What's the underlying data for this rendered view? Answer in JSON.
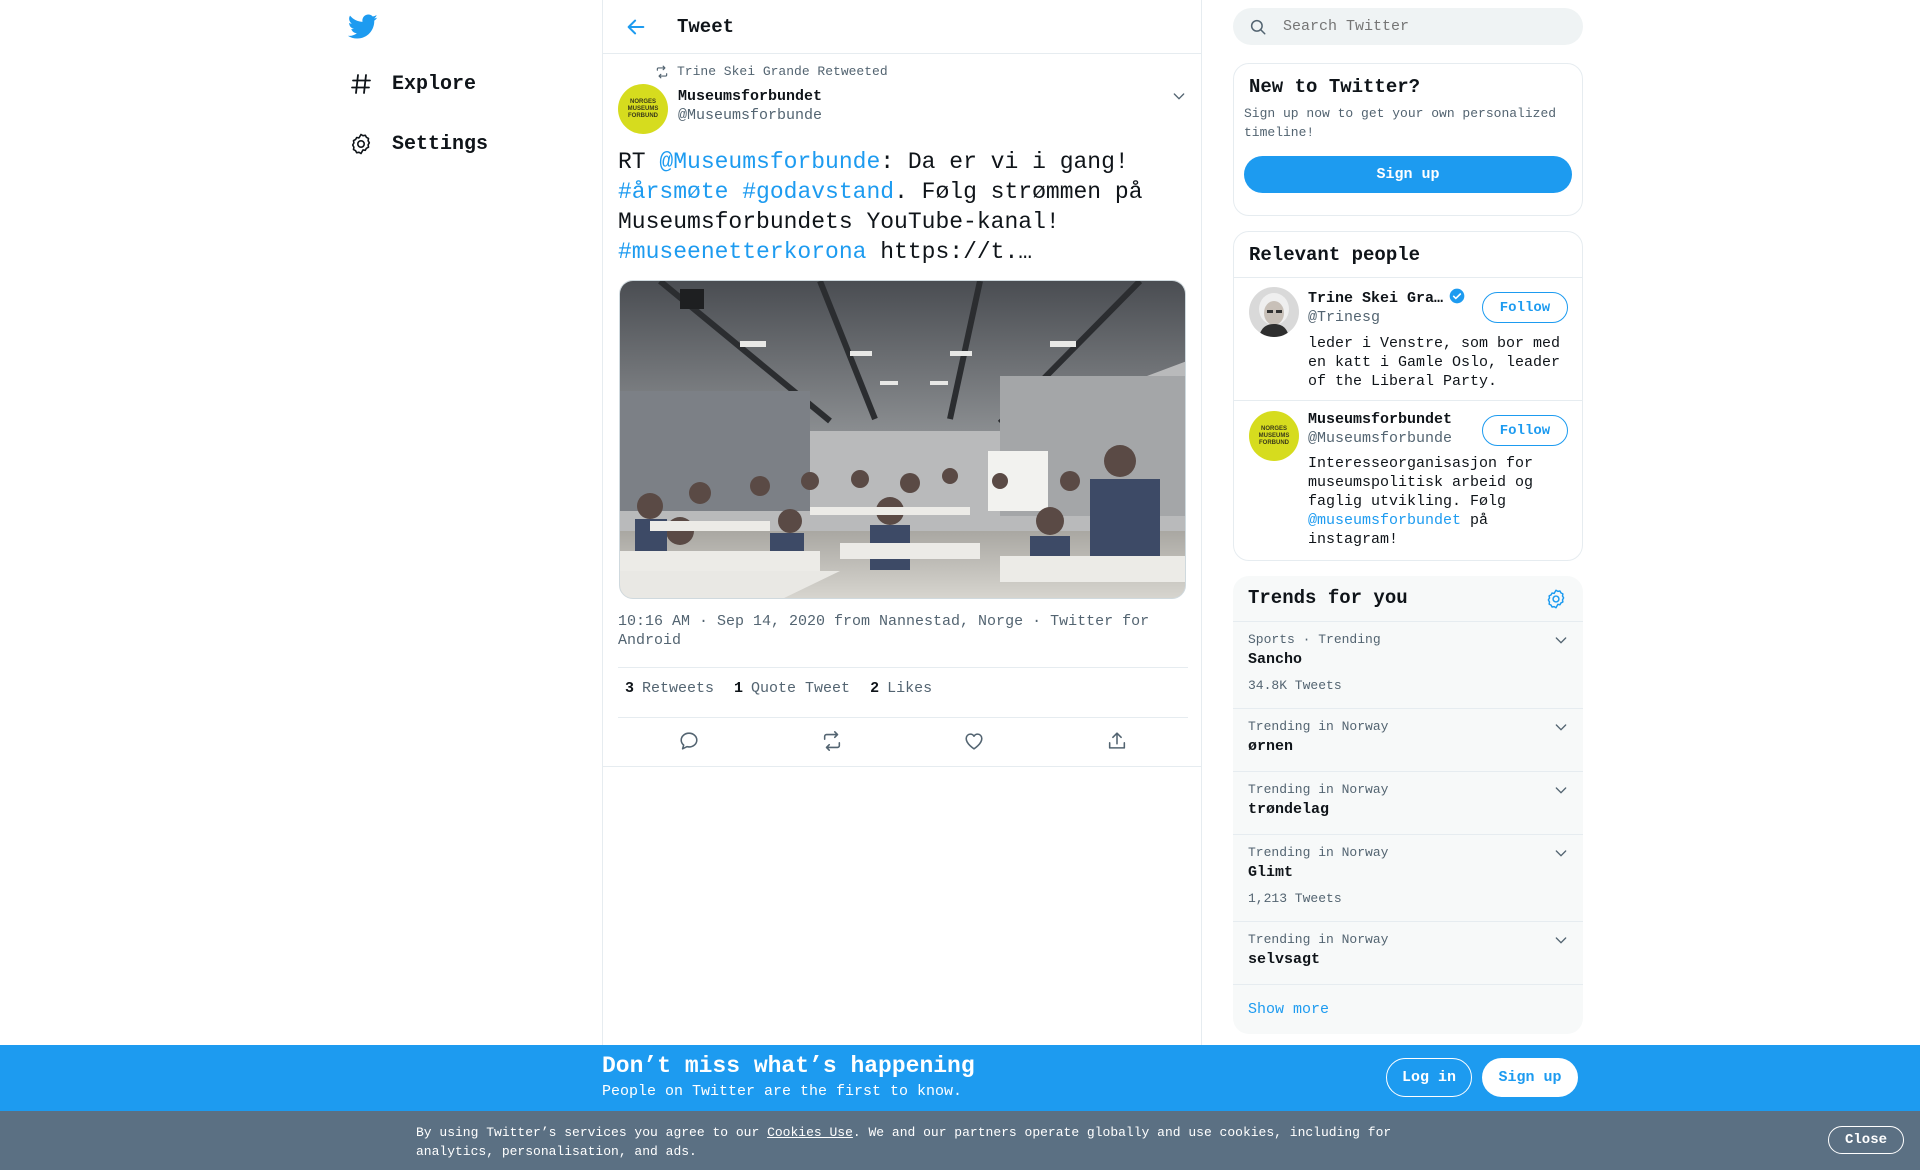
{
  "nav": {
    "items": [
      {
        "label": "Explore",
        "icon": "hashtag-icon"
      },
      {
        "label": "Settings",
        "icon": "gear-icon"
      }
    ]
  },
  "header": {
    "title": "Tweet"
  },
  "tweet": {
    "retweeted_by": "Trine Skei Grande Retweeted",
    "author_name": "Museumsforbundet",
    "author_handle": "@Museumsforbunde",
    "avatar_text": [
      "NORGES",
      "MUSEUMS",
      "FORBUND"
    ],
    "text_parts": [
      {
        "t": "RT ",
        "link": false
      },
      {
        "t": "@Museumsforbunde",
        "link": true
      },
      {
        "t": ": Da er vi i gang! ",
        "link": false
      },
      {
        "t": "#årsmøte",
        "link": true
      },
      {
        "t": " ",
        "link": false
      },
      {
        "t": "#godavstand",
        "link": true
      },
      {
        "t": ". Følg strømmen på Museumsforbundets YouTube-kanal! ",
        "link": false
      },
      {
        "t": "#museenetterkorona",
        "link": true
      },
      {
        "t": " https://t.…",
        "link": false
      }
    ],
    "meta_time": "10:16 AM · Sep 14, 2020 from Nannestad, Norge",
    "meta_source": "Twitter for Android",
    "retweets_count": "3",
    "retweets_label": "Retweets",
    "quotes_count": "1",
    "quotes_label": "Quote Tweet",
    "likes_count": "2",
    "likes_label": "Likes"
  },
  "search": {
    "placeholder": "Search Twitter"
  },
  "new_to_twitter": {
    "title": "New to Twitter?",
    "text": "Sign up now to get your own personalized timeline!",
    "button": "Sign up"
  },
  "relevant_people": {
    "title": "Relevant people",
    "people": [
      {
        "name": "Trine Skei Gra…",
        "handle": "@Trinesg",
        "bio": "leder i Venstre, som bor med en katt i Gamle Oslo, leader of the Liberal Party.",
        "follow": "Follow",
        "verified": true
      },
      {
        "name": "Museumsforbundet",
        "handle": "@Museumsforbunde",
        "bio_before": "Interesseorganisasjon for museumspolitisk arbeid og faglig utvikling. Følg ",
        "bio_link": "@museumsforbundet",
        "bio_after": " på instagram!",
        "follow": "Follow"
      }
    ]
  },
  "trends": {
    "title": "Trends for you",
    "items": [
      {
        "context": "Sports · Trending",
        "name": "Sancho",
        "count": "34.8K Tweets"
      },
      {
        "context": "Trending in Norway",
        "name": "ørnen",
        "count": ""
      },
      {
        "context": "Trending in Norway",
        "name": "trøndelag",
        "count": ""
      },
      {
        "context": "Trending in Norway",
        "name": "Glimt",
        "count": "1,213 Tweets"
      },
      {
        "context": "Trending in Norway",
        "name": "selvsagt",
        "count": ""
      }
    ],
    "show_more": "Show more"
  },
  "cta": {
    "title": "Don’t miss what’s happening",
    "subtitle": "People on Twitter are the first to know.",
    "login": "Log in",
    "signup": "Sign up"
  },
  "cookie": {
    "before": "By using Twitter’s services you agree to our ",
    "link": "Cookies Use",
    "after": ". We and our partners operate globally and use cookies, including for analytics, personalisation, and ads.",
    "close": "Close"
  },
  "colors": {
    "accent": "#1d9bf0",
    "cookie_bg": "#5b7083",
    "trends_bg": "#f7f9f9"
  }
}
